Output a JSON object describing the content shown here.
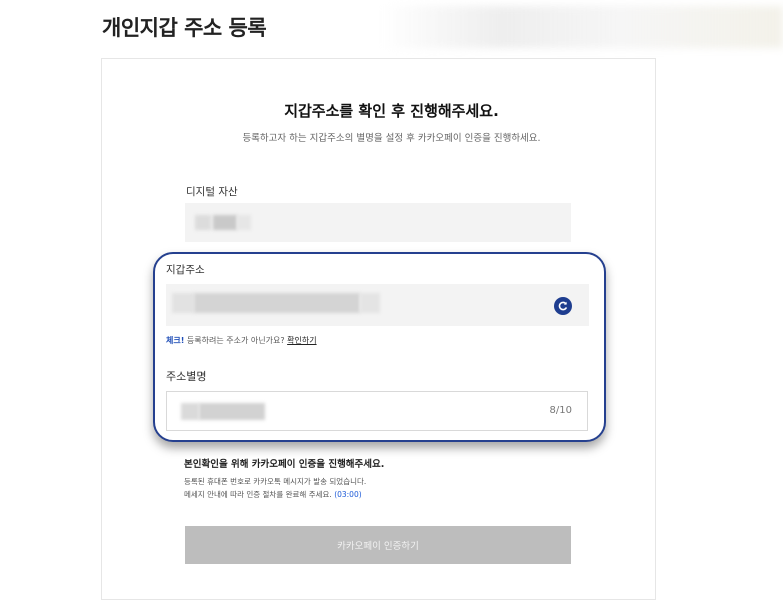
{
  "page": {
    "title": "개인지갑 주소 등록"
  },
  "card": {
    "heading": "지갑주소를 확인 후 진행해주세요.",
    "subheading": "등록하고자 하는 지갑주소의 별명을 설정 후 카카오페이 인증을 진행하세요."
  },
  "digital_asset": {
    "label": "디지털 자산"
  },
  "wallet_address": {
    "label": "지갑주소",
    "refresh_icon": "refresh-icon"
  },
  "check": {
    "tag": "체크!",
    "text": " 등록하려는 주소가 아닌가요?",
    "link": "확인하기"
  },
  "nickname": {
    "label": "주소별명",
    "counter": "8/10"
  },
  "notice": {
    "title": "본인확인을 위해 카카오페이 인증을 진행해주세요.",
    "line1": "등록된 휴대폰 번호로 카카오톡 메시지가 발송 되었습니다.",
    "line2": "메세지 안내에 따라 인증 절차를 완료해 주세요.",
    "timer": "(03:00)"
  },
  "button": {
    "kakao_label": "카카오페이 인증하기"
  },
  "colors": {
    "accent": "#25408f",
    "timer": "#1e5bd8",
    "button_disabled": "#bdbdbd"
  }
}
